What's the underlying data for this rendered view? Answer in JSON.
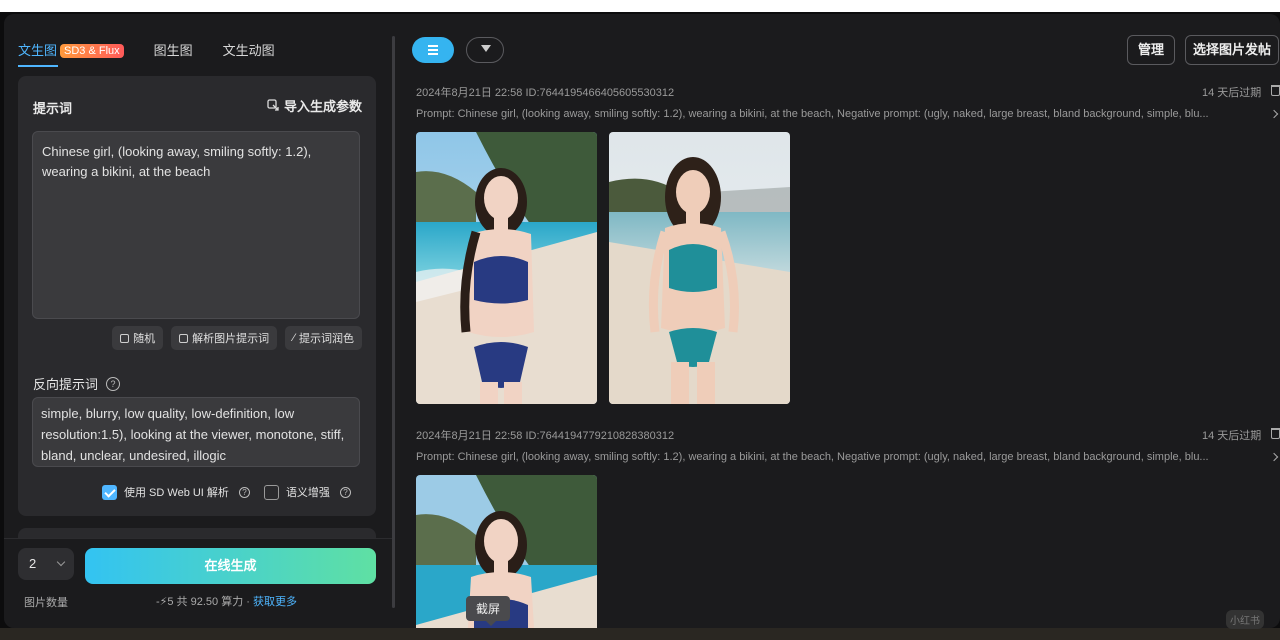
{
  "tabs": [
    {
      "label": "文生图",
      "badge": "SD3 & Flux"
    },
    {
      "label": "图生图"
    },
    {
      "label": "文生动图"
    }
  ],
  "prompt_card": {
    "title": "提示词",
    "import_label": "导入生成参数",
    "prompt_text": "Chinese girl, (looking away, smiling softly: 1.2), wearing a bikini, at the beach",
    "tools": [
      "随机",
      "解析图片提示词",
      "提示词润色"
    ],
    "negative_title": "反向提示词",
    "negative_text": "simple, blurry, low quality, low-definition, low resolution:1.5), looking at the viewer, monotone, stiff, bland, unclear, undesired, illogic",
    "option_sdwebui": "使用 SD Web UI 解析",
    "option_semantic": "语义增强"
  },
  "footer": {
    "quantity": "2",
    "quantity_label": "图片数量",
    "generate_label": "在线生成",
    "cost_prefix": "-⚡5 共 92.50 算力 · ",
    "cost_link": "获取更多"
  },
  "toolbar": {
    "manage_label": "管理",
    "post_label": "选择图片发帖"
  },
  "records": [
    {
      "meta": "2024年8月21日 22:58 ID:764419546640560553​0312",
      "expiry": "14 天后过期",
      "prompt": "Prompt: Chinese girl, (looking away, smiling softly: 1.2), wearing a bikini, at the beach, Negative prompt: (ugly, naked, large breast, bland background, simple, blu..."
    },
    {
      "meta": "2024年8月21日 22:58 ID:7644194779210828380312",
      "expiry": "14 天后过期",
      "prompt": "Prompt: Chinese girl, (looking away, smiling softly: 1.2), wearing a bikini, at the beach, Negative prompt: (ugly, naked, large breast, bland background, simple, blu..."
    }
  ],
  "tooltip": "截屏",
  "watermark": "小红书",
  "colors": {
    "accent": "#4fb6ff",
    "generate_gradient_start": "#33c3f2",
    "generate_gradient_end": "#5fe0a3",
    "badge": "#ff7a4a"
  }
}
